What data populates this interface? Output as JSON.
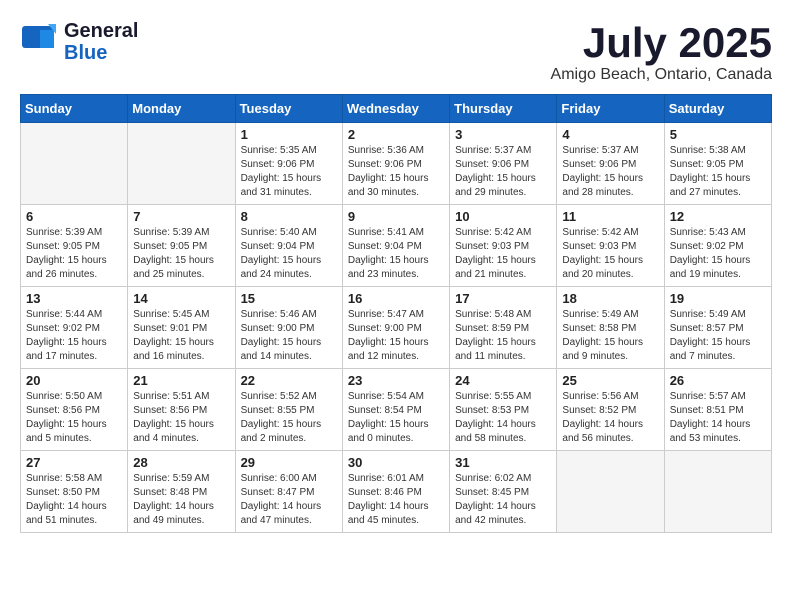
{
  "logo": {
    "line1": "General",
    "line2": "Blue"
  },
  "title": "July 2025",
  "location": "Amigo Beach, Ontario, Canada",
  "weekdays": [
    "Sunday",
    "Monday",
    "Tuesday",
    "Wednesday",
    "Thursday",
    "Friday",
    "Saturday"
  ],
  "weeks": [
    [
      {
        "day": "",
        "content": ""
      },
      {
        "day": "",
        "content": ""
      },
      {
        "day": "1",
        "content": "Sunrise: 5:35 AM\nSunset: 9:06 PM\nDaylight: 15 hours\nand 31 minutes."
      },
      {
        "day": "2",
        "content": "Sunrise: 5:36 AM\nSunset: 9:06 PM\nDaylight: 15 hours\nand 30 minutes."
      },
      {
        "day": "3",
        "content": "Sunrise: 5:37 AM\nSunset: 9:06 PM\nDaylight: 15 hours\nand 29 minutes."
      },
      {
        "day": "4",
        "content": "Sunrise: 5:37 AM\nSunset: 9:06 PM\nDaylight: 15 hours\nand 28 minutes."
      },
      {
        "day": "5",
        "content": "Sunrise: 5:38 AM\nSunset: 9:05 PM\nDaylight: 15 hours\nand 27 minutes."
      }
    ],
    [
      {
        "day": "6",
        "content": "Sunrise: 5:39 AM\nSunset: 9:05 PM\nDaylight: 15 hours\nand 26 minutes."
      },
      {
        "day": "7",
        "content": "Sunrise: 5:39 AM\nSunset: 9:05 PM\nDaylight: 15 hours\nand 25 minutes."
      },
      {
        "day": "8",
        "content": "Sunrise: 5:40 AM\nSunset: 9:04 PM\nDaylight: 15 hours\nand 24 minutes."
      },
      {
        "day": "9",
        "content": "Sunrise: 5:41 AM\nSunset: 9:04 PM\nDaylight: 15 hours\nand 23 minutes."
      },
      {
        "day": "10",
        "content": "Sunrise: 5:42 AM\nSunset: 9:03 PM\nDaylight: 15 hours\nand 21 minutes."
      },
      {
        "day": "11",
        "content": "Sunrise: 5:42 AM\nSunset: 9:03 PM\nDaylight: 15 hours\nand 20 minutes."
      },
      {
        "day": "12",
        "content": "Sunrise: 5:43 AM\nSunset: 9:02 PM\nDaylight: 15 hours\nand 19 minutes."
      }
    ],
    [
      {
        "day": "13",
        "content": "Sunrise: 5:44 AM\nSunset: 9:02 PM\nDaylight: 15 hours\nand 17 minutes."
      },
      {
        "day": "14",
        "content": "Sunrise: 5:45 AM\nSunset: 9:01 PM\nDaylight: 15 hours\nand 16 minutes."
      },
      {
        "day": "15",
        "content": "Sunrise: 5:46 AM\nSunset: 9:00 PM\nDaylight: 15 hours\nand 14 minutes."
      },
      {
        "day": "16",
        "content": "Sunrise: 5:47 AM\nSunset: 9:00 PM\nDaylight: 15 hours\nand 12 minutes."
      },
      {
        "day": "17",
        "content": "Sunrise: 5:48 AM\nSunset: 8:59 PM\nDaylight: 15 hours\nand 11 minutes."
      },
      {
        "day": "18",
        "content": "Sunrise: 5:49 AM\nSunset: 8:58 PM\nDaylight: 15 hours\nand 9 minutes."
      },
      {
        "day": "19",
        "content": "Sunrise: 5:49 AM\nSunset: 8:57 PM\nDaylight: 15 hours\nand 7 minutes."
      }
    ],
    [
      {
        "day": "20",
        "content": "Sunrise: 5:50 AM\nSunset: 8:56 PM\nDaylight: 15 hours\nand 5 minutes."
      },
      {
        "day": "21",
        "content": "Sunrise: 5:51 AM\nSunset: 8:56 PM\nDaylight: 15 hours\nand 4 minutes."
      },
      {
        "day": "22",
        "content": "Sunrise: 5:52 AM\nSunset: 8:55 PM\nDaylight: 15 hours\nand 2 minutes."
      },
      {
        "day": "23",
        "content": "Sunrise: 5:54 AM\nSunset: 8:54 PM\nDaylight: 15 hours\nand 0 minutes."
      },
      {
        "day": "24",
        "content": "Sunrise: 5:55 AM\nSunset: 8:53 PM\nDaylight: 14 hours\nand 58 minutes."
      },
      {
        "day": "25",
        "content": "Sunrise: 5:56 AM\nSunset: 8:52 PM\nDaylight: 14 hours\nand 56 minutes."
      },
      {
        "day": "26",
        "content": "Sunrise: 5:57 AM\nSunset: 8:51 PM\nDaylight: 14 hours\nand 53 minutes."
      }
    ],
    [
      {
        "day": "27",
        "content": "Sunrise: 5:58 AM\nSunset: 8:50 PM\nDaylight: 14 hours\nand 51 minutes."
      },
      {
        "day": "28",
        "content": "Sunrise: 5:59 AM\nSunset: 8:48 PM\nDaylight: 14 hours\nand 49 minutes."
      },
      {
        "day": "29",
        "content": "Sunrise: 6:00 AM\nSunset: 8:47 PM\nDaylight: 14 hours\nand 47 minutes."
      },
      {
        "day": "30",
        "content": "Sunrise: 6:01 AM\nSunset: 8:46 PM\nDaylight: 14 hours\nand 45 minutes."
      },
      {
        "day": "31",
        "content": "Sunrise: 6:02 AM\nSunset: 8:45 PM\nDaylight: 14 hours\nand 42 minutes."
      },
      {
        "day": "",
        "content": ""
      },
      {
        "day": "",
        "content": ""
      }
    ]
  ]
}
